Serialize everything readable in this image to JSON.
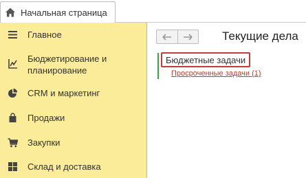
{
  "tabs": [
    {
      "label": "Начальная страница",
      "icon": "home-icon"
    }
  ],
  "sidebar": {
    "items": [
      {
        "label": "Главное",
        "icon": "menu-lines-icon"
      },
      {
        "label": "Бюджетирование и планирование",
        "icon": "budget-chart-icon"
      },
      {
        "label": "CRM и маркетинг",
        "icon": "pie-chart-icon"
      },
      {
        "label": "Продажи",
        "icon": "shopping-bag-icon"
      },
      {
        "label": "Закупки",
        "icon": "shopping-cart-icon"
      },
      {
        "label": "Склад и доставка",
        "icon": "warehouse-grid-icon"
      }
    ]
  },
  "main": {
    "title": "Текущие дела",
    "group": "Бюджетные задачи",
    "link": "Просроченные задачи (1)"
  },
  "colors": {
    "sidebar_bg": "#fbec9a",
    "highlight_border": "#c33a3a",
    "link": "#c0392b",
    "green_marker": "#3aa34a"
  }
}
